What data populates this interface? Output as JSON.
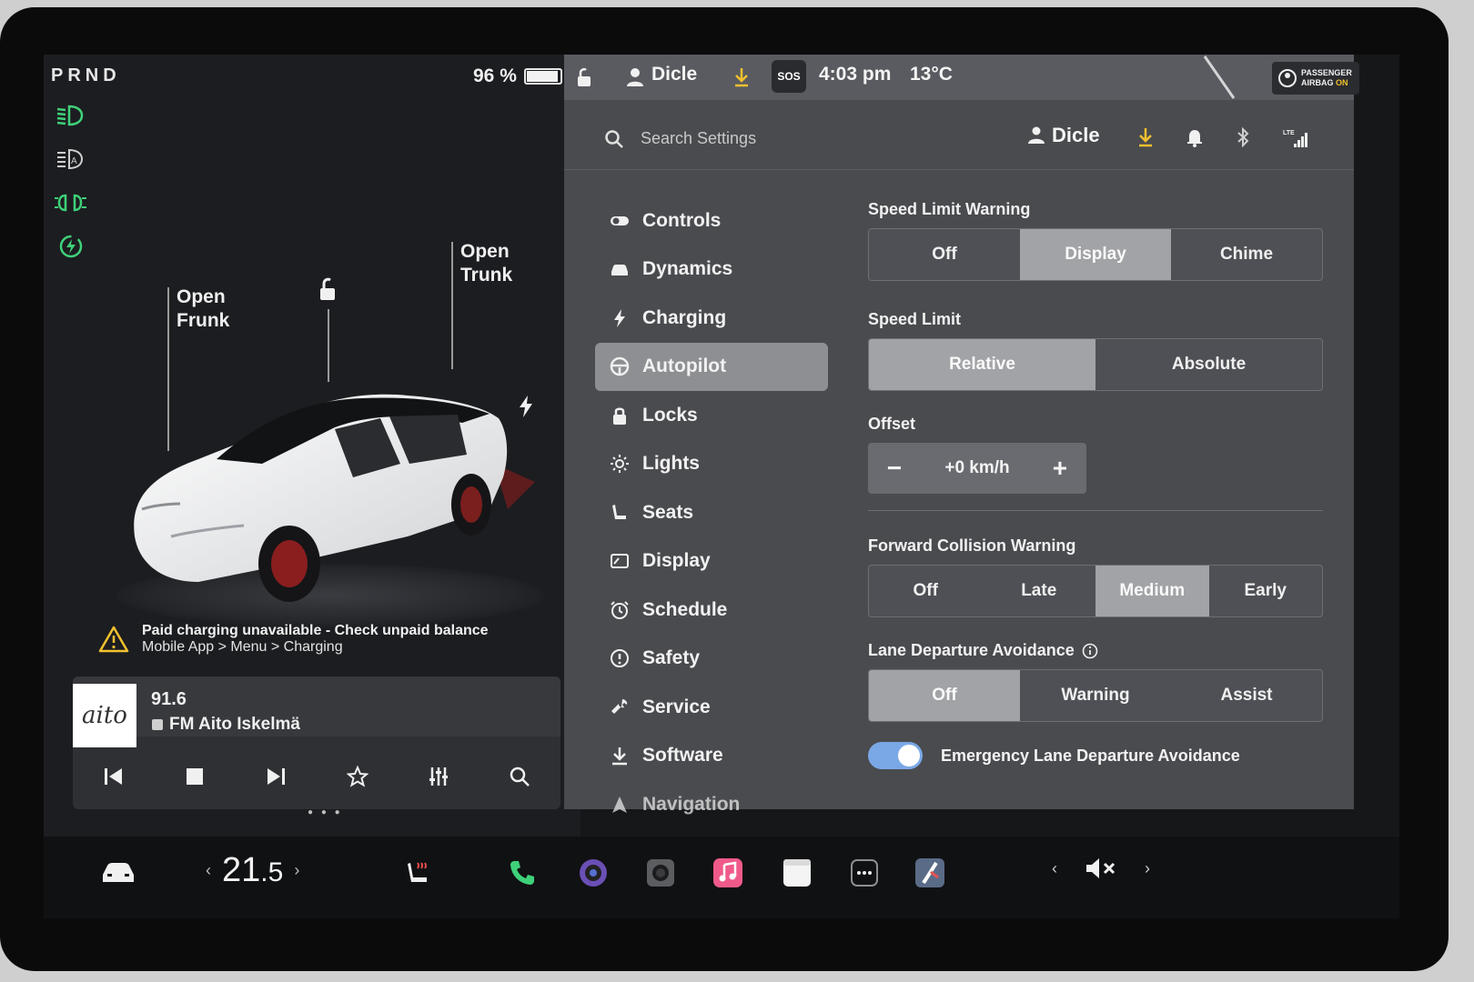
{
  "left": {
    "gear": "PRND",
    "battery_percent": "96 %",
    "battery_level": 0.96,
    "open_frunk": "Open\nFrunk",
    "open_trunk": "Open\nTrunk",
    "warning_line1": "Paid charging unavailable - Check unpaid balance",
    "warning_line2": "Mobile App > Menu > Charging",
    "media": {
      "logo_text": "aito",
      "frequency": "91.6",
      "station": "FM Aito Iskelmä"
    }
  },
  "topbar": {
    "user": "Dicle",
    "sos": "SOS",
    "time": "4:03 pm",
    "temperature": "13°C",
    "airbag_line1": "PASSENGER",
    "airbag_line2": "AIRBAG",
    "airbag_state": "ON"
  },
  "search": {
    "placeholder": "Search Settings",
    "user": "Dicle",
    "lte": "LTE"
  },
  "menu": [
    {
      "label": "Controls"
    },
    {
      "label": "Dynamics"
    },
    {
      "label": "Charging"
    },
    {
      "label": "Autopilot",
      "active": true
    },
    {
      "label": "Locks"
    },
    {
      "label": "Lights"
    },
    {
      "label": "Seats"
    },
    {
      "label": "Display"
    },
    {
      "label": "Schedule"
    },
    {
      "label": "Safety"
    },
    {
      "label": "Service"
    },
    {
      "label": "Software"
    },
    {
      "label": "Navigation"
    }
  ],
  "settings": {
    "speed_limit_warning": {
      "label": "Speed Limit Warning",
      "options": [
        "Off",
        "Display",
        "Chime"
      ],
      "selected": "Display"
    },
    "speed_limit": {
      "label": "Speed Limit",
      "options": [
        "Relative",
        "Absolute"
      ],
      "selected": "Relative"
    },
    "offset": {
      "label": "Offset",
      "value": "+0 km/h"
    },
    "forward_collision": {
      "label": "Forward Collision Warning",
      "options": [
        "Off",
        "Late",
        "Medium",
        "Early"
      ],
      "selected": "Medium"
    },
    "lane_departure": {
      "label": "Lane Departure Avoidance",
      "options": [
        "Off",
        "Warning",
        "Assist"
      ],
      "selected": "Off"
    },
    "emergency_lane": {
      "label": "Emergency Lane Departure Avoidance",
      "enabled": true
    }
  },
  "dock": {
    "temperature_int": "21",
    "temperature_dec": ".5"
  },
  "colors": {
    "accent_green": "#3fd17a",
    "accent_yellow": "#f2c12e",
    "toggle_blue": "#7aa8e6"
  }
}
